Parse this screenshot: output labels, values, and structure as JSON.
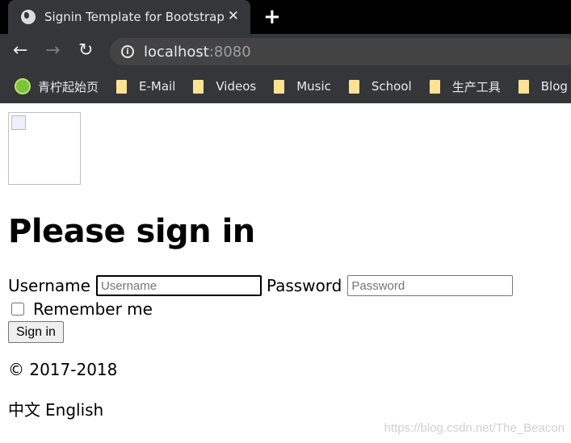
{
  "browser": {
    "tab_title": "Signin Template for Bootstrap",
    "url_host": "localhost",
    "url_port": ":8080",
    "bookmarks": [
      "青柠起始页",
      "E-Mail",
      "Videos",
      "Music",
      "School",
      "生产工具",
      "Blog"
    ]
  },
  "page": {
    "heading": "Please sign in",
    "username_label": "Username",
    "username_placeholder": "Username",
    "password_label": "Password",
    "password_placeholder": "Password",
    "remember_label": "Remember me",
    "signin_label": "Sign in",
    "copyright": "© 2017-2018",
    "lang_zh": "中文",
    "lang_en": "English",
    "watermark": "https://blog.csdn.net/The_Beacon"
  }
}
